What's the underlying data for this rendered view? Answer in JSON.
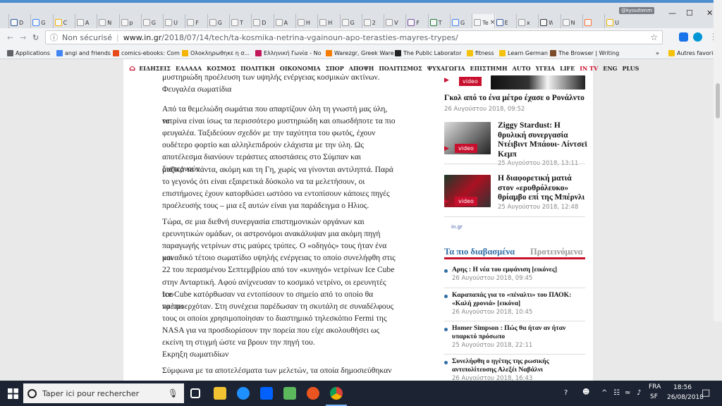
{
  "browser": {
    "profile_name": "@kyouitenm",
    "tabs": [
      {
        "letter": "D",
        "color": "#2b579a"
      },
      {
        "letter": "G",
        "color": "#4285f4"
      },
      {
        "letter": "C",
        "color": "#f4b400"
      },
      {
        "letter": "A",
        "color": "#999999"
      },
      {
        "letter": "N",
        "color": "#999999"
      },
      {
        "letter": "p",
        "color": "#999999"
      },
      {
        "letter": "G",
        "color": "#999999"
      },
      {
        "letter": "U",
        "color": "#999999"
      },
      {
        "letter": "F",
        "color": "#999999"
      },
      {
        "letter": "G",
        "color": "#999999"
      },
      {
        "letter": "T",
        "color": "#999999"
      },
      {
        "letter": "D",
        "color": "#999999"
      },
      {
        "letter": "A",
        "color": "#999999"
      },
      {
        "letter": "H",
        "color": "#999999"
      },
      {
        "letter": "H",
        "color": "#999999"
      },
      {
        "letter": "G",
        "color": "#999999"
      },
      {
        "letter": "2",
        "color": "#999999"
      },
      {
        "letter": "V",
        "color": "#999999"
      },
      {
        "letter": "F",
        "color": "#7b4ea3"
      },
      {
        "letter": "T",
        "color": "#1e7e34"
      },
      {
        "letter": "G si",
        "color": "#4285f4"
      },
      {
        "letter": "Te",
        "color": "#999999",
        "active": true
      },
      {
        "letter": "E",
        "color": "#3b5ba5"
      },
      {
        "letter": "x",
        "color": "#999999"
      },
      {
        "letter": "W",
        "color": "#333333"
      },
      {
        "letter": "N",
        "color": "#999999"
      },
      {
        "letter": "",
        "color": "#ff7139"
      },
      {
        "letter": "U",
        "color": "#f4b400"
      }
    ],
    "tab_close": "×",
    "window_controls": {
      "minimize": "—",
      "maximize": "☐",
      "close": "✕"
    },
    "security_label": "Non sécurisé",
    "url_domain": "www.in.gr",
    "url_path": "/2018/07/14/tech/ta-kosmika-netrina-vgainoun-apo-terasties-mayres-trypes/"
  },
  "bookmarks": [
    {
      "label": "Applications",
      "color": "#5f6368"
    },
    {
      "label": "angi and friends",
      "color": "#4285f4"
    },
    {
      "label": "comics-ebooks: Com",
      "color": "#e64a19"
    },
    {
      "label": "Ολοκληρωθηκε η σ...",
      "color": "#f4b400"
    },
    {
      "label": "Ελληνική Γωνία - No",
      "color": "#c2185b"
    },
    {
      "label": "Warezgr, Greek Ware",
      "color": "#f57c00"
    },
    {
      "label": "The Public Laborator",
      "color": "#222222"
    },
    {
      "label": "fitness",
      "color": "#f4c20d"
    },
    {
      "label": "Learn German",
      "color": "#f4c20d"
    },
    {
      "label": "The Browser | Writing",
      "color": "#7b4b2a"
    }
  ],
  "bookmarks_more": "»",
  "bookmarks_other": "Autres favoris",
  "site_nav": [
    "ΕΙΔΗΣΕΙΣ",
    "ΕΛΛΑΔΑ",
    "ΚΟΣΜΟΣ",
    "ΠΟΛΙΤΙΚΗ",
    "ΟΙΚΟΝΟΜΙΑ",
    "ΣΠΟΡ",
    "ΑΠΟΨΗ",
    "ΠΟΛΙΤΙΣΜΟΣ",
    "ΨΥΧΑΓΩΓΙΑ",
    "ΕΠΙΣΤΗΜΗ",
    "AUTO",
    "ΥΓΕΙΑ",
    "LIFE",
    "IN TV",
    "ENG",
    "PLUS"
  ],
  "article": {
    "top_lines": [
      "μυστηριώδη προέλευση των υψηλής ενέργειας κοσμικών ακτίνων.",
      "Φευγαλέα σωματίδια"
    ],
    "para1": [
      "Από τα θεμελιώδη σωμάτια που απαρτίζουν όλη τη γνωστή μας ύλη, τα",
      "νετρίνα είναι ίσως τα περισσότερο μυστηριώδη και οπωσδήποτε τα πιο",
      "φευγαλέα. Ταξιδεύουν σχεδόν με την ταχύτητα του φωτός, έχουν",
      "ουδέτερο φορτίο και αλληλεπιδρούν ελάχιστα με την ύλη. Ως",
      "αποτέλεσμα διανύουν τεράστιες αποστάσεις στο Σύμπαν και διαπερνούν",
      "μαζικά τα πάντα, ακόμη και τη Γη, χωρίς να γίνονται αντιληπτά. Παρά",
      "το γεγονός ότι είναι εξαιρετικά δύσκολο να τα μελετήσουν, οι",
      "επιστήμονες έχουν κατορθώσει ωστόσο να εντοπίσουν κάποιες πηγές",
      "προέλευσής τους – μια εξ αυτών είναι για παράδειγμα ο Ηλιος."
    ],
    "para2": [
      "Τώρα, σε μια διεθνή συνεργασία επιστημονικών οργάνων και",
      "ερευνητικών ομάδων, οι αστρονόμοι ανακάλυψαν μια ακόμη πηγή",
      "παραγωγής νετρίνων στις μαύρες τρύπες. Ο «οδηγός» τους ήταν ένα και",
      "μοναδικό τέτοιο σωματίδιο υψηλής ενέργειας το οποίο συνελήφθη στις",
      "22 του περασμένου Σεπτεμβρίου από τον «κυνηγό» νετρίνων Ice Cube",
      "στην Ανταρτική. Αφού ανίχνευσαν το κοσμικό νετρίνο, οι ερευνητές του",
      "Ice Cube κατόρθωσαν να εντοπίσουν το σημείο από το οποίο θα πρέπει",
      "να προερχόταν. Στη συνέχεια παρέδωσαν τη σκυτάλη σε συναδέλφους",
      "τους οι οποίοι χρησιμοποίησαν το διαστημικό τηλεσκόπιο Fermi της",
      "NASA για να προσδιορίσουν την πορεία που είχε ακολουθήσει ως",
      "εκείνη τη στιγμή ώστε να βρουν την πηγή του.",
      "Εκρηξη σωματιδίων"
    ],
    "para3": [
      "Σύμφωνα με τα αποτελέσματα των μελετών, τα οποία δημοσιεύθηκαν"
    ]
  },
  "sidebar": {
    "top_badge": "video",
    "top_title": "Γκολ από το ένα μέτρο έχασε ο Ρονάλντο",
    "top_date": "26 Αυγούστου 2018, 09:52",
    "videos": [
      {
        "title": [
          "Ziggy Stardust: Η",
          "θρυλική συνεργασία",
          "Ντέιβιντ Μπάουι- Λίντσεϊ",
          "Κεμπ"
        ],
        "date": "25 Αυγούστου 2018, 13:11",
        "badge": "video"
      },
      {
        "title": [
          "Η διαφορετική ματιά",
          "στον «ερυθρόλευκο»",
          "θρίαμβο επί της Μπέρνλι"
        ],
        "date": "25 Αυγούστου 2018, 12:48",
        "badge": "video"
      }
    ],
    "ad_label": "in.gr",
    "tab_active": "Τα πιο διαβασμένα",
    "tab_inactive": "Προτεινόμενα",
    "list": [
      {
        "title": [
          "Αρης : Η νέα του εμφάνιση [εικόνες]"
        ],
        "date": "26 Αυγούστου 2018, 09:45"
      },
      {
        "title": [
          "Καραπαπάς για το «πέναλτι» του ΠΑΟΚ:",
          "«Καλή χρονιά» [εικόνα]"
        ],
        "date": "26 Αυγούστου 2018, 10:45"
      },
      {
        "title": [
          "Homer Simpson : Πώς θα ήταν αν ήταν",
          "υπαρκτό πρόσωπο"
        ],
        "date": "25 Αυγούστου 2018, 22:11"
      },
      {
        "title": [
          "Συνελήφθη ο ηγέτης της ρωσικής",
          "αντιπολίτευσης Αλεξέι Ναβάλνι"
        ],
        "date": "26 Αυγούστου 2018, 16:43"
      }
    ]
  },
  "taskbar": {
    "search_placeholder": "Taper ici pour rechercher",
    "lang_top": "FRA",
    "lang_bottom": "SF",
    "time": "18:56",
    "date": "26/08/2018"
  }
}
